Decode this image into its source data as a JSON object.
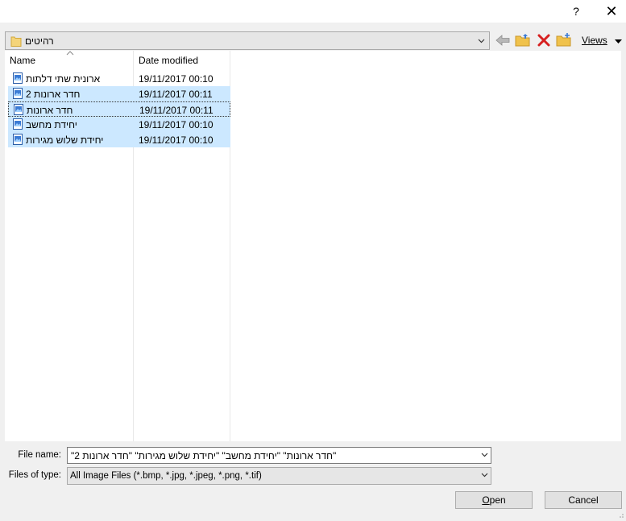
{
  "titlebar": {
    "help": "?",
    "close": "✕"
  },
  "look_in": {
    "folder": "רהיטים"
  },
  "toolbar": {
    "views_label": "Views"
  },
  "file_list": {
    "columns": {
      "name": "Name",
      "date": "Date modified"
    },
    "rows": [
      {
        "name": "ארונית שתי דלתות",
        "date": "19/11/2017 00:10"
      },
      {
        "name": "חדר ארונות 2",
        "date": "19/11/2017 00:11"
      },
      {
        "name": "חדר ארונות",
        "date": "19/11/2017 00:11"
      },
      {
        "name": "יחידת מחשב",
        "date": "19/11/2017 00:10"
      },
      {
        "name": "יחידת שלוש מגירות",
        "date": "19/11/2017 00:10"
      }
    ]
  },
  "file_name": {
    "label": "File name:",
    "value": "\"חדר ארונות\" \"יחידת מחשב\" \"יחידת שלוש מגירות\" \"חדר ארונות 2\""
  },
  "file_type": {
    "label": "Files of type:",
    "value": "All Image Files (*.bmp, *.jpg, *.jpeg, *.png, *.tif)"
  },
  "buttons": {
    "open_first": "O",
    "open_rest": "pen",
    "cancel": "Cancel"
  }
}
